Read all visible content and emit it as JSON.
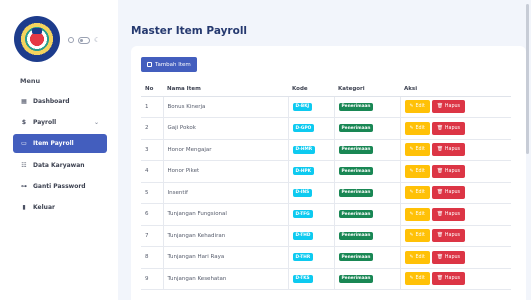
{
  "sidebar": {
    "menu_title": "Menu",
    "items": [
      {
        "label": "Dashboard",
        "icon": "grid-icon",
        "active": false
      },
      {
        "label": "Payroll",
        "icon": "dollar-icon",
        "active": false,
        "has_chevron": true
      },
      {
        "label": "Item Payroll",
        "icon": "folder-icon",
        "active": true
      },
      {
        "label": "Data Karyawan",
        "icon": "users-icon",
        "active": false
      },
      {
        "label": "Ganti Password",
        "icon": "key-icon",
        "active": false
      },
      {
        "label": "Keluar",
        "icon": "exit-icon",
        "active": false
      }
    ]
  },
  "page": {
    "title": "Master Item Payroll",
    "add_button": "Tambah Item"
  },
  "table": {
    "headers": [
      "No",
      "Nama Item",
      "Kode",
      "Kategori",
      "Aksi"
    ],
    "edit_label": "Edit",
    "delete_label": "Hapus",
    "rows": [
      {
        "no": "1",
        "name": "Bonus Kinerja",
        "code": "D-BKJ",
        "category": "Penerimaan"
      },
      {
        "no": "2",
        "name": "Gaji Pokok",
        "code": "D-GPO",
        "category": "Penerimaan"
      },
      {
        "no": "3",
        "name": "Honor Mengajar",
        "code": "D-HMR",
        "category": "Penerimaan"
      },
      {
        "no": "4",
        "name": "Honor Piket",
        "code": "D-HPK",
        "category": "Penerimaan"
      },
      {
        "no": "5",
        "name": "Insentif",
        "code": "D-INS",
        "category": "Penerimaan"
      },
      {
        "no": "6",
        "name": "Tunjangan Fungsional",
        "code": "D-TFG",
        "category": "Penerimaan"
      },
      {
        "no": "7",
        "name": "Tunjangan Kehadiran",
        "code": "D-THD",
        "category": "Penerimaan"
      },
      {
        "no": "8",
        "name": "Tunjangan Hari Raya",
        "code": "D-THR",
        "category": "Penerimaan"
      },
      {
        "no": "9",
        "name": "Tunjangan Kesehatan",
        "code": "D-TKS",
        "category": "Penerimaan"
      }
    ]
  },
  "colors": {
    "accent": "#435ebe",
    "code_badge": "#0dcaf0",
    "category_badge": "#198754",
    "edit": "#ffc107",
    "delete": "#dc3545"
  }
}
